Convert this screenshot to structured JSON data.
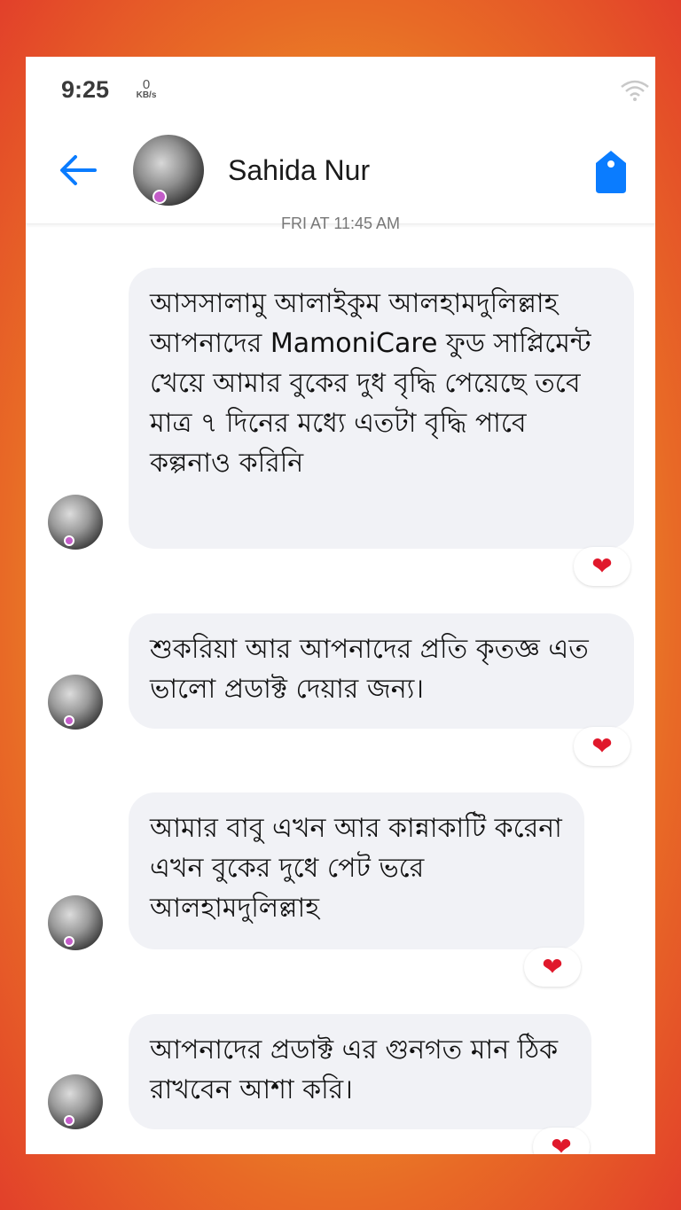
{
  "status_bar": {
    "time": "9:25",
    "net_speed_value": "0",
    "net_speed_unit": "KB/s"
  },
  "header": {
    "contact_name": "Sahida Nur"
  },
  "timestamp_separator": "FRI AT 11:45 AM",
  "messages": [
    {
      "text": "আসসালামু আলাইকুম আলহামদুলিল্লাহ  আপনাদের MamoniCare ফুড সাপ্লিমেন্ট খেয়ে আমার বুকের দুধ বৃদ্ধি পেয়েছে তবে মাত্র ৭ দিনের মধ্যে এতটা বৃদ্ধি পাবে কল্পনাও করিনি",
      "reaction": "❤"
    },
    {
      "text": "শুকরিয়া আর আপনাদের প্রতি কৃতজ্ঞ এত ভালো প্রডাক্ট দেয়ার জন্য।",
      "reaction": "❤"
    },
    {
      "text": "আমার বাবু এখন আর কান্নাকাটি করেনা এখন বুকের দুধে পেট ভরে আলহামদুলিল্লাহ",
      "reaction": "❤"
    },
    {
      "text": "আপনাদের প্রডাক্ট এর গুনগত মান ঠিক রাখবেন আশা করি।",
      "reaction": "❤"
    }
  ],
  "colors": {
    "accent": "#0a7cff",
    "bubble": "#f1f2f6",
    "heart": "#e0182b"
  }
}
